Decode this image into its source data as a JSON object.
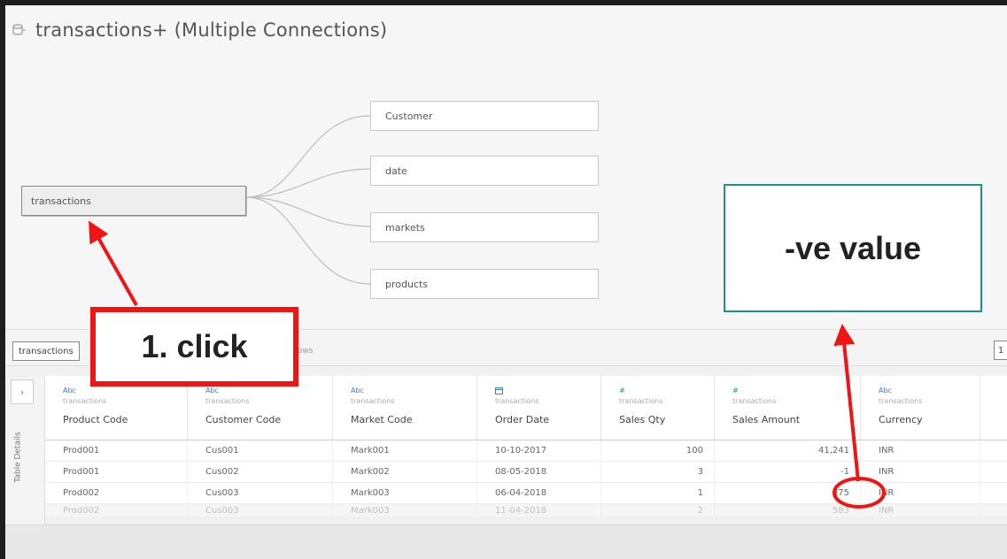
{
  "window": {
    "title": "transactions+ (Multiple Connections)",
    "db_icon": "database-icon"
  },
  "model": {
    "primary_table": "transactions",
    "related_tables": [
      "Customer",
      "date",
      "markets",
      "products"
    ]
  },
  "annotations": {
    "callout_label": "-ve value",
    "click_label": "1. click",
    "accent_red": "#f01414",
    "accent_teal": "#1e8f86"
  },
  "data_pane": {
    "table_tag": "transactions",
    "fields_info": "7 fields 1000 rows",
    "right_button": "1",
    "side_tab_label": "Table Details",
    "side_expand_icon": "chevron-right-icon",
    "columns": [
      {
        "type": "Abc",
        "source": "transactions",
        "name": "Product Code"
      },
      {
        "type": "Abc",
        "source": "transactions",
        "name": "Customer Code"
      },
      {
        "type": "Abc",
        "source": "transactions",
        "name": "Market Code"
      },
      {
        "type": "calendar",
        "source": "transactions",
        "name": "Order Date"
      },
      {
        "type": "#",
        "source": "transactions",
        "name": "Sales Qty"
      },
      {
        "type": "#",
        "source": "transactions",
        "name": "Sales Amount"
      },
      {
        "type": "Abc",
        "source": "transactions",
        "name": "Currency"
      }
    ],
    "rows": [
      [
        "Prod001",
        "Cus001",
        "Mark001",
        "10-10-2017",
        "100",
        "41,241",
        "INR"
      ],
      [
        "Prod001",
        "Cus002",
        "Mark002",
        "08-05-2018",
        "3",
        "-1",
        "INR"
      ],
      [
        "Prod002",
        "Cus003",
        "Mark003",
        "06-04-2018",
        "1",
        "875",
        "INR"
      ],
      [
        "Prod002",
        "Cus003",
        "Mark003",
        "11-04-2018",
        "2",
        "583",
        "INR"
      ]
    ]
  }
}
